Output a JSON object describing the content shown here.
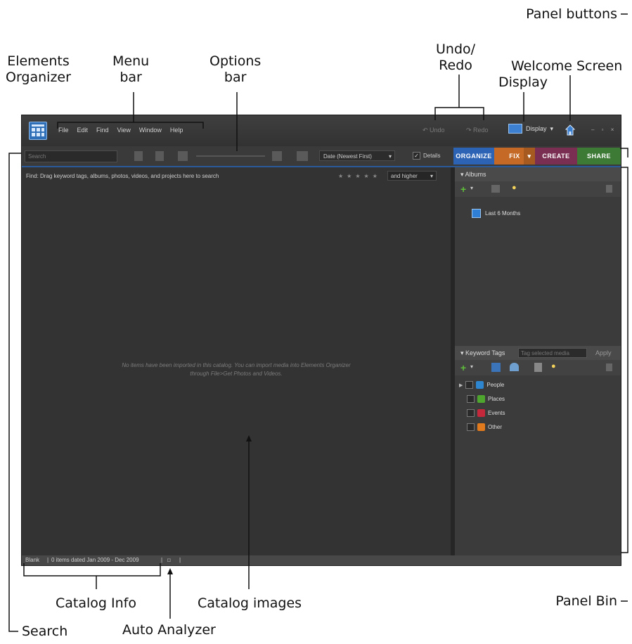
{
  "callouts": {
    "elements_organizer": "Elements\nOrganizer",
    "menu_bar": "Menu\nbar",
    "options_bar": "Options\nbar",
    "undo_redo": "Undo/\nRedo",
    "welcome_screen": "Welcome Screen",
    "display": "Display",
    "panel_buttons": "Panel buttons",
    "catalog_info": "Catalog Info",
    "catalog_images": "Catalog images",
    "panel_bin": "Panel Bin",
    "search": "Search",
    "auto_analyzer": "Auto Analyzer"
  },
  "menu": [
    "File",
    "Edit",
    "Find",
    "View",
    "Window",
    "Help"
  ],
  "titlebar": {
    "undo": "Undo",
    "redo": "Redo",
    "display": "Display"
  },
  "options": {
    "search_placeholder": "Search",
    "sort": "Date (Newest First)",
    "details": "Details"
  },
  "tabs": [
    {
      "label": "ORGANIZE",
      "color": "#2d63b4"
    },
    {
      "label": "FIX",
      "color": "#c46a26"
    },
    {
      "label": "CREATE",
      "color": "#7a2f52"
    },
    {
      "label": "SHARE",
      "color": "#3d7a36"
    }
  ],
  "main": {
    "find_text": "Find: Drag keyword tags, albums, photos, videos, and projects here to search",
    "rating_filter": "and higher",
    "empty_message": "No items have been imported in this catalog. You can import media into Elements Organizer through File>Get Photos and Videos."
  },
  "albums": {
    "title": "Albums",
    "items": [
      "Last 6 Months"
    ]
  },
  "keyword_tags": {
    "title": "Keyword Tags",
    "placeholder": "Tag selected media",
    "apply": "Apply",
    "items": [
      {
        "label": "People",
        "color": "#2f86d0"
      },
      {
        "label": "Places",
        "color": "#4fa62e"
      },
      {
        "label": "Events",
        "color": "#c4283a"
      },
      {
        "label": "Other",
        "color": "#e07a1c"
      }
    ]
  },
  "status": {
    "catalog": "Blank",
    "info": "0 items dated Jan 2009 - Dec 2009"
  }
}
